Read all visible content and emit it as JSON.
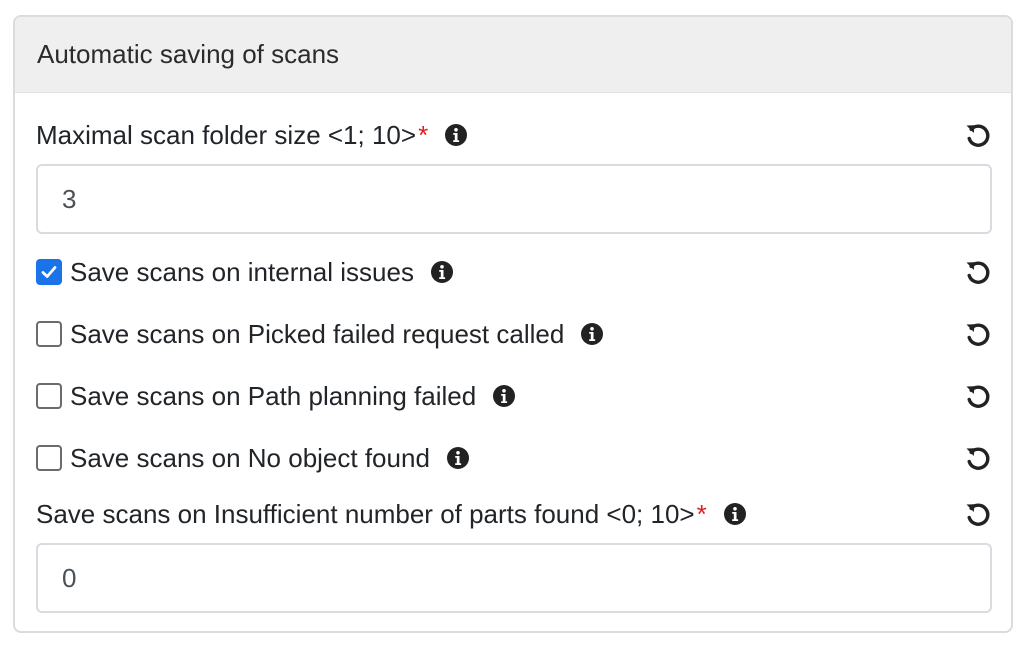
{
  "header": {
    "title": "Automatic saving of scans"
  },
  "max_folder_size": {
    "label": "Maximal scan folder size <1; 10>",
    "required_mark": "*",
    "value": "3"
  },
  "checkboxes": [
    {
      "label": "Save scans on internal issues",
      "checked": true
    },
    {
      "label": "Save scans on Picked failed request called",
      "checked": false
    },
    {
      "label": "Save scans on Path planning failed",
      "checked": false
    },
    {
      "label": "Save scans on No object found",
      "checked": false
    }
  ],
  "insufficient_parts": {
    "label": "Save scans on Insufficient number of parts found <0; 10>",
    "required_mark": "*",
    "value": "0"
  },
  "icons": {
    "info": "info-circle-icon",
    "reset": "undo-icon",
    "check": "checkmark-icon"
  },
  "colors": {
    "checkbox_checked": "#1a73e8",
    "required": "#e11d1d",
    "header_bg": "#efefef"
  }
}
